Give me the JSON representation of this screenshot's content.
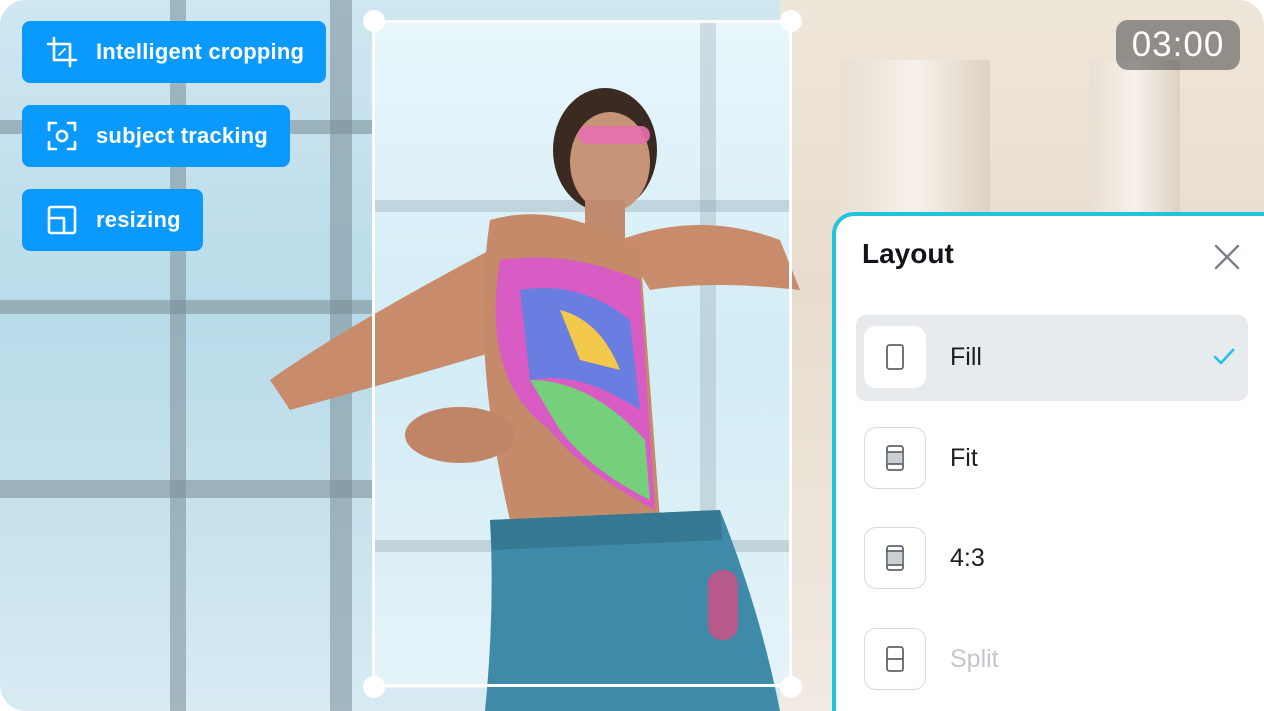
{
  "features": [
    {
      "label": "Intelligent cropping",
      "icon": "crop-icon"
    },
    {
      "label": "subject tracking",
      "icon": "focus-target-icon"
    },
    {
      "label": "resizing",
      "icon": "resize-icon"
    }
  ],
  "timer": "03:00",
  "layout_panel": {
    "title": "Layout",
    "options": [
      {
        "label": "Fill",
        "icon": "fill-layout-icon",
        "selected": true
      },
      {
        "label": "Fit",
        "icon": "fit-layout-icon",
        "selected": false
      },
      {
        "label": "4:3",
        "icon": "aspect-4-3-icon",
        "selected": false
      },
      {
        "label": "Split",
        "icon": "split-layout-icon",
        "selected": false
      }
    ]
  },
  "colors": {
    "pill": "#0a99ff",
    "panel_border": "#22c3dd",
    "check": "#22c3dd"
  }
}
